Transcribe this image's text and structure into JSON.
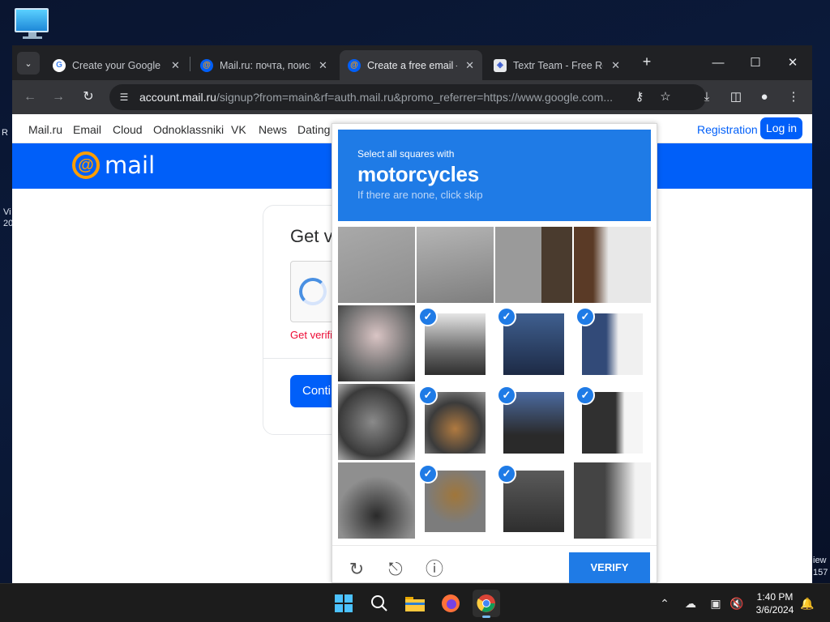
{
  "desktop": {
    "left_edge_texts": [
      "R",
      "Vi",
      "20"
    ],
    "right_edge_texts": [
      "iew",
      "157"
    ]
  },
  "browser": {
    "tabs": [
      {
        "title": "Create your Google Account",
        "favicon": "google-icon",
        "active": false
      },
      {
        "title": "Mail.ru: почта, поиск в интернете",
        "favicon": "mailru-icon",
        "active": false
      },
      {
        "title": "Create a free email — Mail.ru",
        "favicon": "mailru-icon",
        "active": true
      },
      {
        "title": "Textr Team - Free Receive SMS",
        "favicon": "shield-icon",
        "active": false
      }
    ],
    "new_tab_label": "+",
    "window_controls": {
      "minimize": "—",
      "maximize": "☐",
      "close": "✕"
    },
    "url": {
      "host": "account.mail.ru",
      "path": "/signup?from=main&rf=auth.mail.ru&promo_referrer=https://www.google.com..."
    }
  },
  "page": {
    "nav_links": [
      "Mail.ru",
      "Email",
      "Cloud",
      "Odnoklassniki",
      "VK",
      "News",
      "Dating"
    ],
    "registration_label": "Registration",
    "login_label": "Log in",
    "brand": {
      "at": "@",
      "name": "mail"
    },
    "card": {
      "title": "Get v",
      "error": "Get verifi",
      "continue_label": "Conti"
    }
  },
  "captcha": {
    "prompt": "Select all squares with",
    "target": "motorcycles",
    "hint": "If there are none, click skip",
    "selected": [
      false,
      false,
      false,
      false,
      false,
      true,
      true,
      true,
      false,
      true,
      true,
      true,
      false,
      true,
      true,
      false
    ],
    "verify_label": "VERIFY",
    "icons": [
      "refresh-icon",
      "audio-icon",
      "info-icon"
    ]
  },
  "taskbar": {
    "apps": [
      "start-icon",
      "search-icon",
      "file-explorer-icon",
      "firefox-icon",
      "chrome-icon"
    ],
    "time": "1:40 PM",
    "date": "3/6/2024"
  },
  "colors": {
    "brand_blue": "#005ff9",
    "captcha_blue": "#1f7be6",
    "brand_orange": "#ff9e00",
    "error_red": "#ed0a34"
  }
}
